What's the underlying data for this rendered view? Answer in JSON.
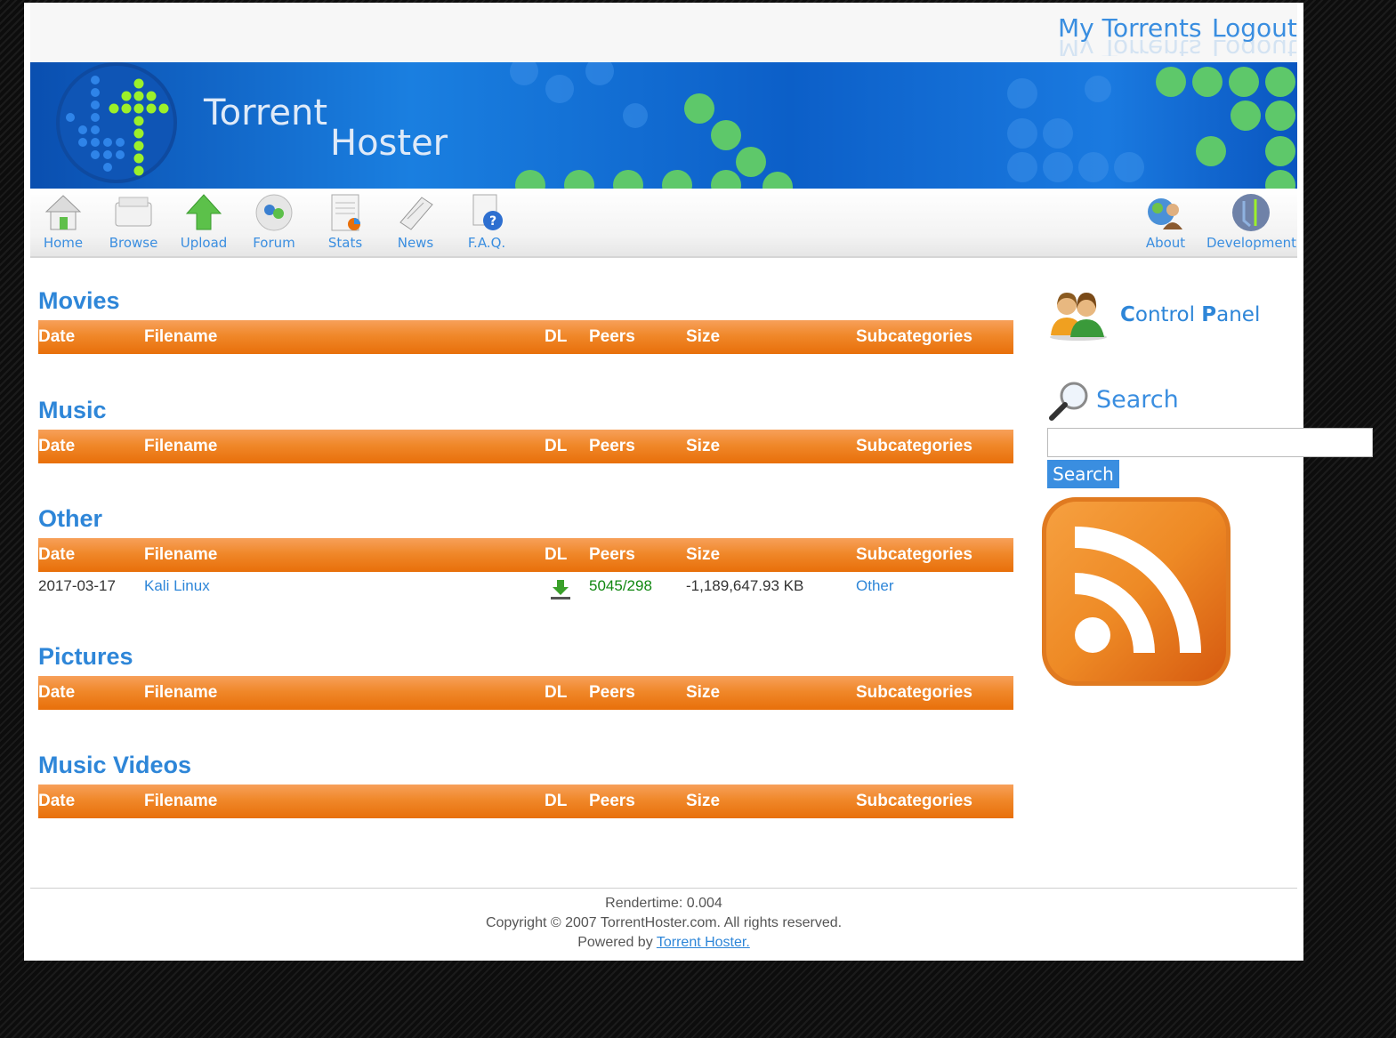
{
  "header": {
    "links": {
      "my_torrents": "My Torrents",
      "logout": "Logout"
    },
    "logo": {
      "line1": "Torrent",
      "line2": "Hoster"
    }
  },
  "nav": {
    "left": [
      {
        "label": "Home",
        "icon": "home-icon"
      },
      {
        "label": "Browse",
        "icon": "browse-icon"
      },
      {
        "label": "Upload",
        "icon": "upload-icon"
      },
      {
        "label": "Forum",
        "icon": "forum-icon"
      },
      {
        "label": "Stats",
        "icon": "stats-icon"
      },
      {
        "label": "News",
        "icon": "news-icon"
      },
      {
        "label": "F.A.Q.",
        "icon": "faq-icon"
      }
    ],
    "right": [
      {
        "label": "About",
        "icon": "about-icon"
      },
      {
        "label": "Development",
        "icon": "development-icon"
      }
    ]
  },
  "table_headers": {
    "date": "Date",
    "filename": "Filename",
    "dl": "DL",
    "peers": "Peers",
    "size": "Size",
    "subcategories": "Subcategories"
  },
  "categories": [
    {
      "title": "Movies",
      "rows": []
    },
    {
      "title": "Music",
      "rows": []
    },
    {
      "title": "Other",
      "rows": [
        {
          "date": "2017-03-17",
          "filename": "Kali Linux",
          "peers": "5045/298",
          "size": "-1,189,647.93 KB",
          "subcategory": "Other"
        }
      ]
    },
    {
      "title": "Pictures",
      "rows": []
    },
    {
      "title": "Music Videos",
      "rows": []
    }
  ],
  "sidebar": {
    "control_panel": {
      "first": "C",
      "mid": "ontrol ",
      "first2": "P",
      "rest": "anel"
    },
    "search": {
      "title": "Search",
      "input_value": "",
      "button": "Search"
    }
  },
  "footer": {
    "rendertime": "Rendertime: 0.004",
    "copyright": "Copyright © 2007 TorrentHoster.com. All rights reserved.",
    "powered_prefix": "Powered by ",
    "powered_link": "Torrent Hoster."
  },
  "colors": {
    "accent": "#2e86d8",
    "header_orange": "#f0882a",
    "peers_green": "#118811"
  }
}
